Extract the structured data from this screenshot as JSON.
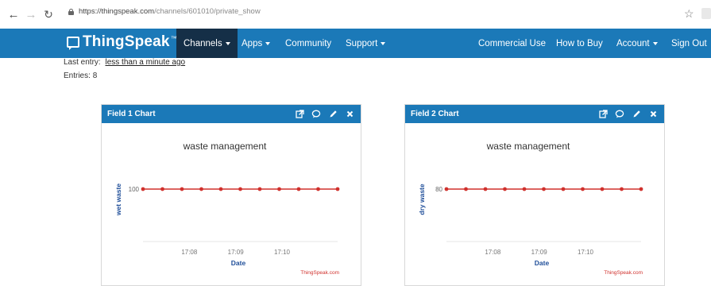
{
  "browser": {
    "url_host": "https://thingspeak.com",
    "url_path": "/channels/601010/private_show"
  },
  "nav": {
    "brand": "ThingSpeak",
    "brand_mark": "™",
    "channels": "Channels",
    "apps": "Apps",
    "community": "Community",
    "support": "Support",
    "commercial_use": "Commercial Use",
    "how_to_buy": "How to Buy",
    "account": "Account",
    "sign_out": "Sign Out"
  },
  "channel": {
    "last_entry_label": "Last entry:",
    "last_entry_value": "less than a minute ago",
    "entries_label": "Entries:",
    "entries_value": "8"
  },
  "colors": {
    "navbar": "#1b79b8",
    "nav_active": "#152f47",
    "series_line": "#d0312d",
    "axis_title": "#1f4e99"
  },
  "panels": [
    {
      "title": "Field 1 Chart",
      "chart_data": {
        "type": "line",
        "title": "waste management",
        "ylabel": "wet waste",
        "xlabel": "Date",
        "credit": "ThingSpeak.com",
        "y_tick_labels": [
          "100"
        ],
        "x_tick_labels": [
          "17:08",
          "17:09",
          "17:10"
        ],
        "x_ticks": [
          1,
          2,
          3
        ],
        "x_range": [
          0,
          4.2
        ],
        "ylim": [
          90,
          110
        ],
        "x": [
          0,
          0.42,
          0.84,
          1.26,
          1.68,
          2.1,
          2.52,
          2.94,
          3.36,
          3.78,
          4.2
        ],
        "y": [
          100,
          100,
          100,
          100,
          100,
          100,
          100,
          100,
          100,
          100,
          100
        ],
        "grid": false
      }
    },
    {
      "title": "Field 2 Chart",
      "chart_data": {
        "type": "line",
        "title": "waste management",
        "ylabel": "dry waste",
        "xlabel": "Date",
        "credit": "ThingSpeak.com",
        "y_tick_labels": [
          "80"
        ],
        "x_tick_labels": [
          "17:08",
          "17:09",
          "17:10"
        ],
        "x_ticks": [
          1,
          2,
          3
        ],
        "x_range": [
          0,
          4.2
        ],
        "ylim": [
          70,
          90
        ],
        "x": [
          0,
          0.42,
          0.84,
          1.26,
          1.68,
          2.1,
          2.52,
          2.94,
          3.36,
          3.78,
          4.2
        ],
        "y": [
          80,
          80,
          80,
          80,
          80,
          80,
          80,
          80,
          80,
          80,
          80
        ],
        "grid": false
      }
    }
  ]
}
